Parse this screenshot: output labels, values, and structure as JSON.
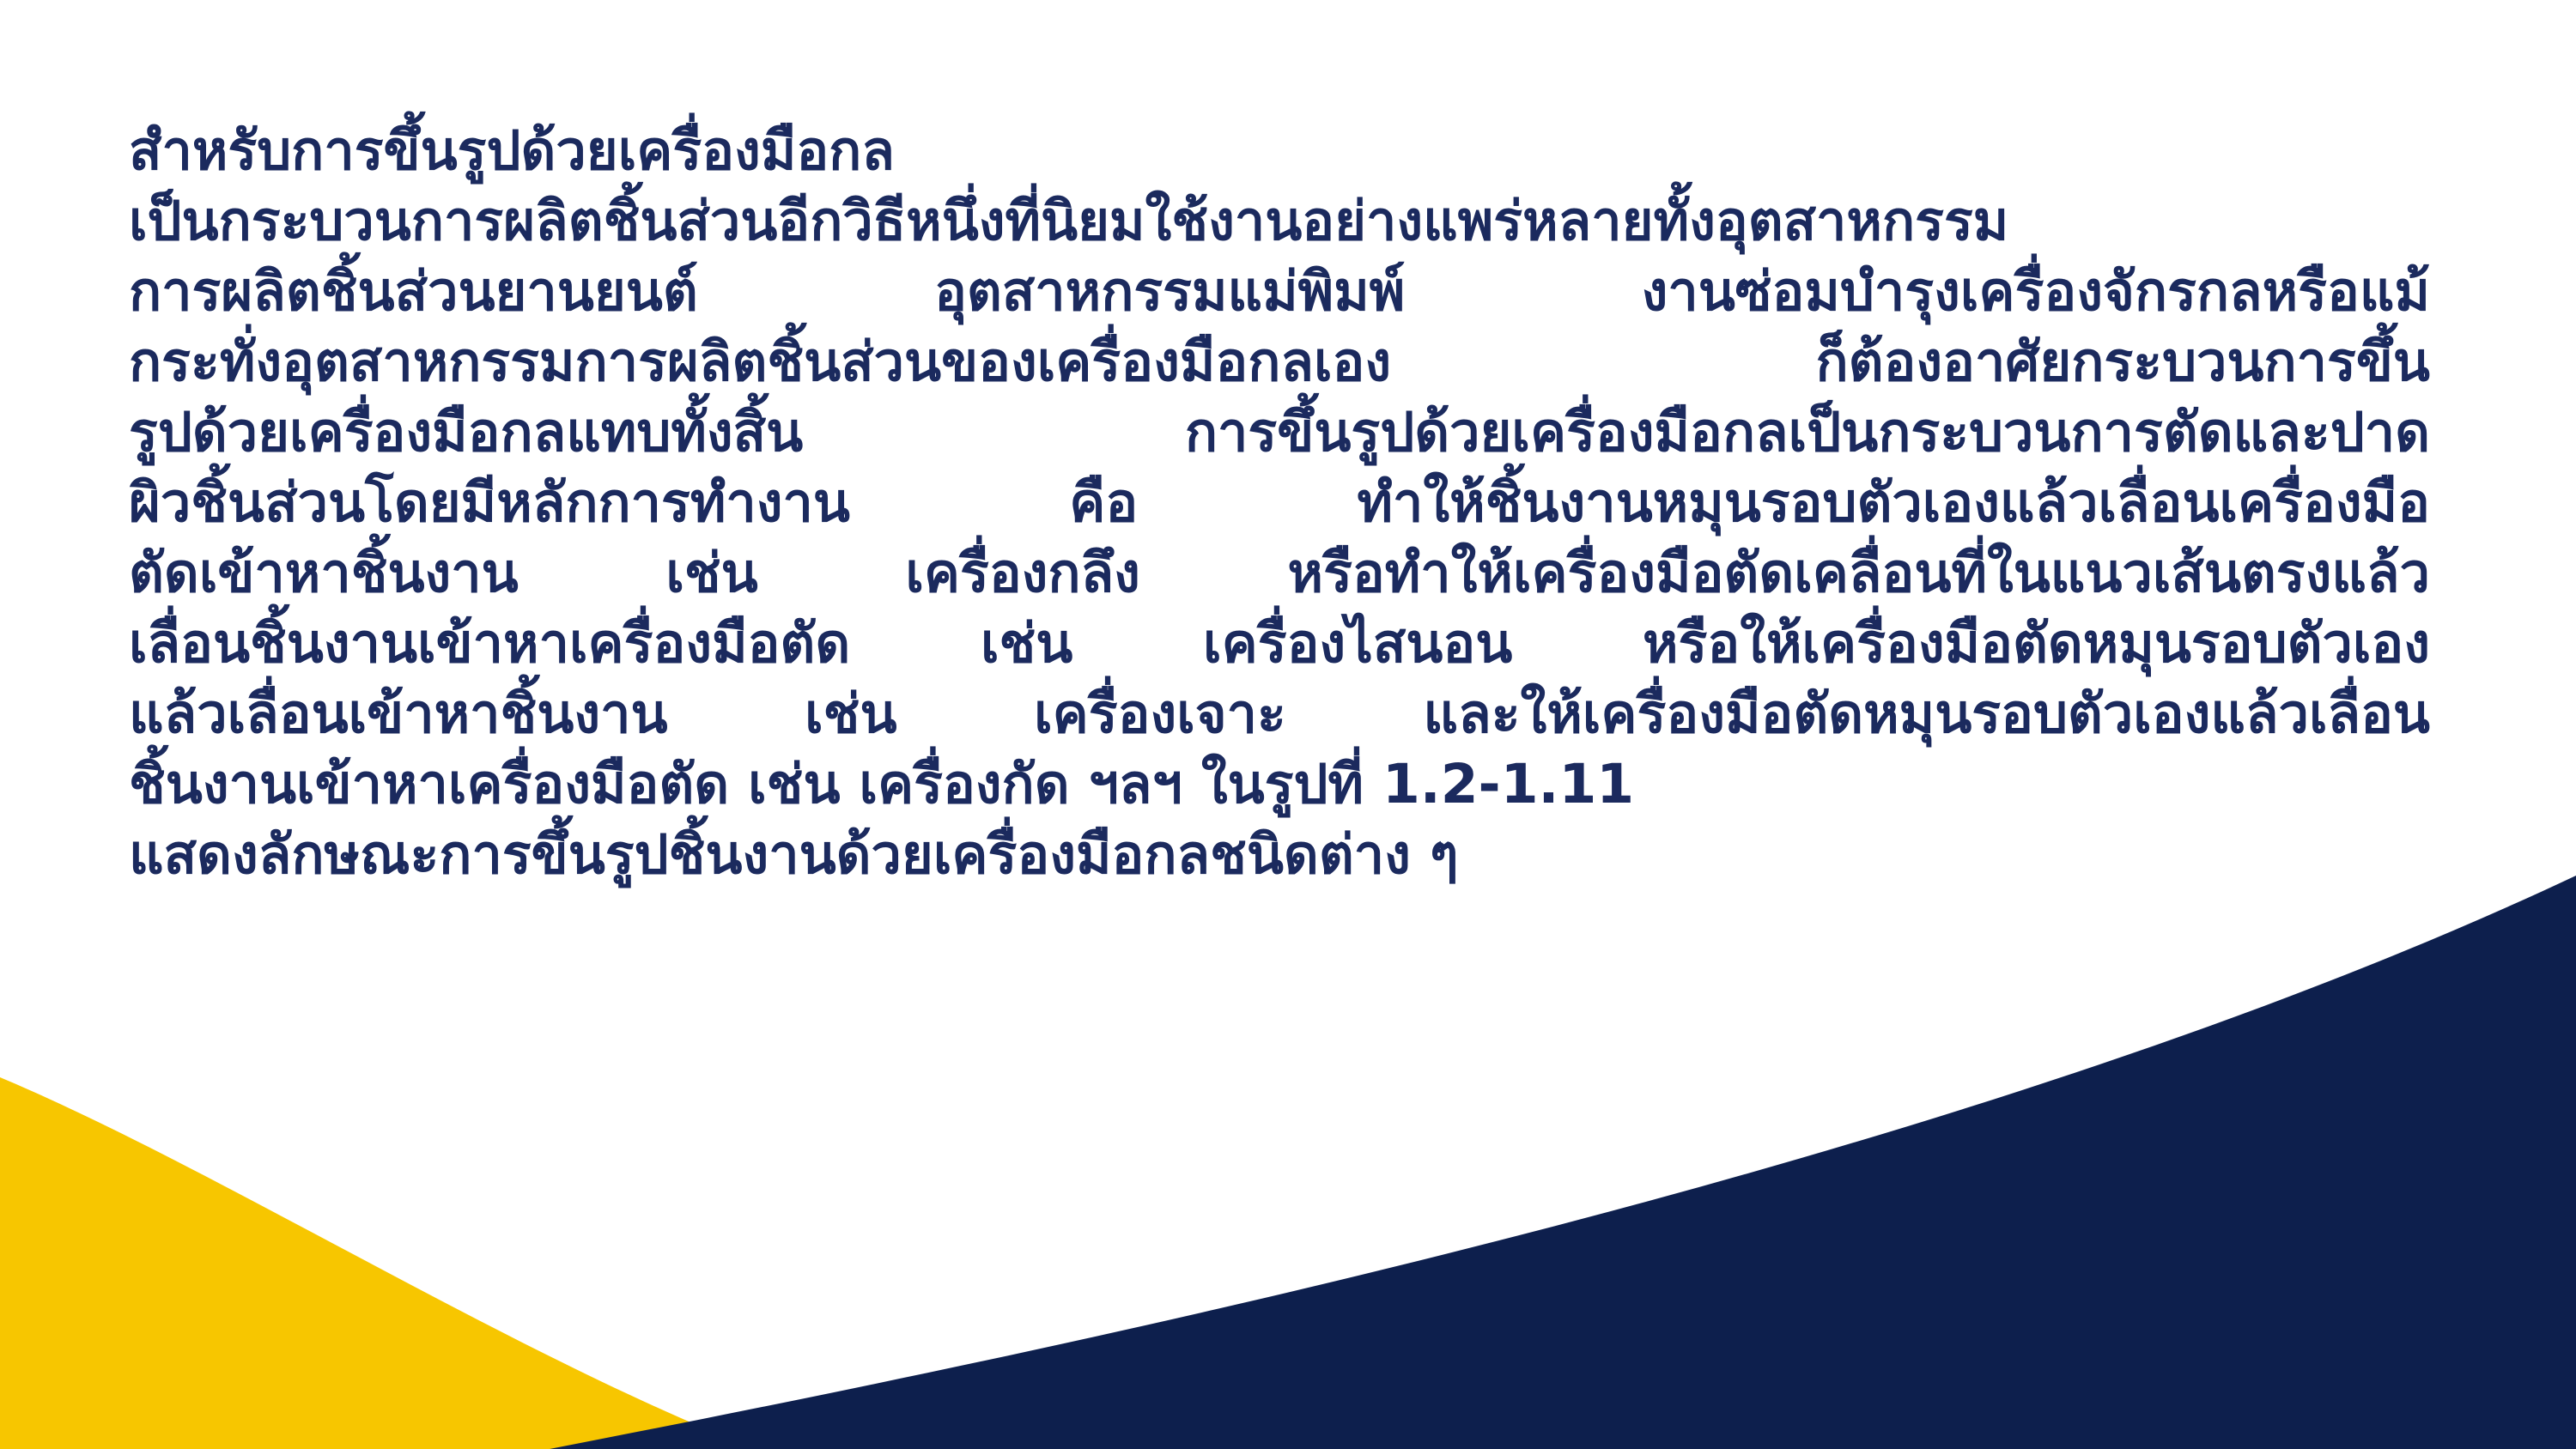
{
  "colors": {
    "background": "#ffffff",
    "text": "#1b2a5e",
    "navy_wave": "#0d1f4d",
    "yellow_wave": "#f7c600"
  },
  "body": {
    "lines": [
      "สำหรับการขึ้นรูปด้วยเครื่องมือกล",
      "เป็นกระบวนการผลิตชิ้นส่วนอีกวิธีหนึ่งที่นิยมใช้งานอย่างแพร่หลายทั้งอุตสาหกรรม",
      "การผลิตชิ้นส่วนยานยนต์    อุตสาหกรรมแม่พิมพ์    งานซ่อมบำรุงเครื่องจักรกลหรือแม้",
      "กระทั่งอุตสาหกรรมการผลิตชิ้นส่วนของเครื่องมือกลเอง    ก็ต้องอาศัยกระบวนการขึ้น",
      "รูปด้วยเครื่องมือกลแทบทั้งสิ้น การขึ้นรูปด้วยเครื่องมือกลเป็นกระบวนการตัดและปาด",
      "ผิวชิ้นส่วนโดยมีหลักการทำงาน   คือ   ทำให้ชิ้นงานหมุนรอบตัวเองแล้วเลื่อนเครื่องมือ",
      "ตัดเข้าหาชิ้นงาน  เช่น  เครื่องกลึง  หรือทำให้เครื่องมือตัดเคลื่อนที่ในแนวเส้นตรงแล้ว",
      "เลื่อนชิ้นงานเข้าหาเครื่องมือตัด เช่น เครื่องไสนอน หรือให้เครื่องมือตัดหมุนรอบตัวเอง",
      "แล้วเลื่อนเข้าหาชิ้นงาน เช่น เครื่องเจาะ และให้เครื่องมือตัดหมุนรอบตัวเองแล้วเลื่อน",
      "ชิ้นงานเข้าหาเครื่องมือตัด เช่น เครื่องกัด ฯลฯ ในรูปที่ 1.2-1.11",
      "แสดงลักษณะการขึ้นรูปชิ้นงานด้วยเครื่องมือกลชนิดต่าง ๆ"
    ]
  }
}
